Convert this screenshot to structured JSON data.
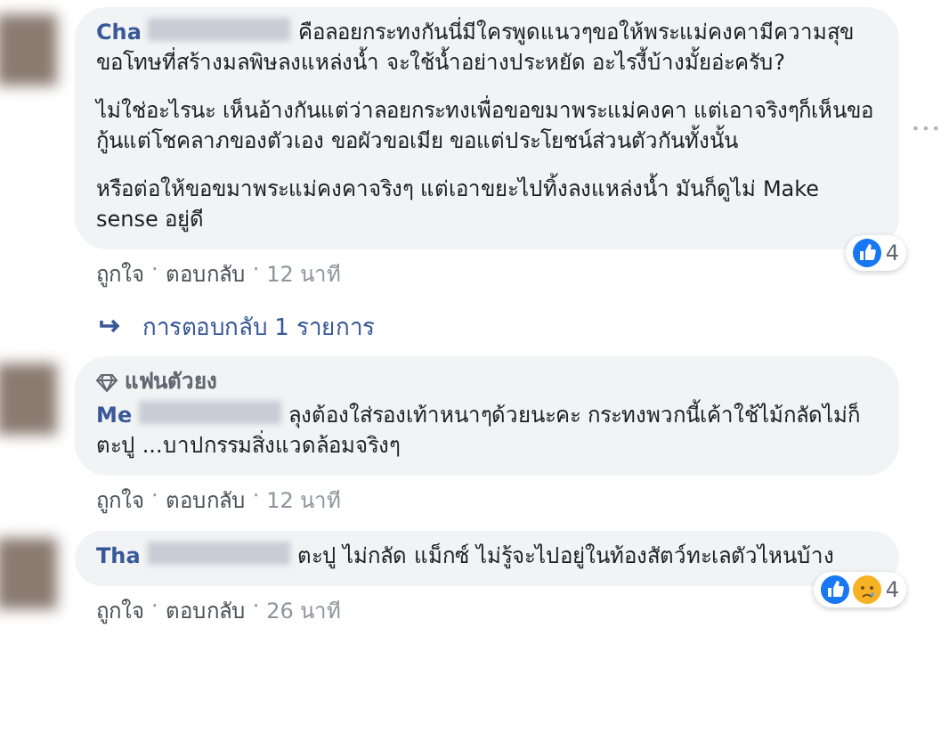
{
  "comments": [
    {
      "author": "Cha",
      "paragraphs": [
        "คือลอยกระทงกันนี่มีใครพูดแนวๆขอให้พระแม่คงคามีความสุข ขอโทษที่สร้างมลพิษลงแหล่งน้ำ จะใช้น้ำอย่างประหยัด อะไรงี้บ้างมั้ยอ่ะครับ?",
        "ไม่ใช่อะไรนะ เห็นอ้างกันแต่ว่าลอยกระทงเพื่อขอขมาพระแม่คงคา แต่เอาจริงๆก็เห็นขอกู้นแต่โชคลาภของตัวเอง ขอผัวขอเมีย ขอแต่ประโยชน์ส่วนตัวกันทั้งนั้น",
        "หรือต่อให้ขอขมาพระแม่คงคาจริงๆ แต่เอาขยะไปทิ้งลงแหล่งน้ำ มันก็ดูไม่ Make sense อยู่ดี"
      ],
      "reactions": [
        {
          "kind": "like"
        }
      ],
      "reaction_count": "4",
      "actions": [
        {
          "kind": "link",
          "text": "ถูกใจ"
        },
        {
          "kind": "dot",
          "text": "·"
        },
        {
          "kind": "link",
          "text": "ตอบกลับ"
        },
        {
          "kind": "dot",
          "text": "·"
        },
        {
          "kind": "time",
          "text": "12 นาที"
        }
      ],
      "replies_link": "การตอบกลับ 1 รายการ",
      "more_button": "•••"
    },
    {
      "author": "Me",
      "badge": "แฟนตัวยง",
      "paragraphs": [
        "ลุงต้องใส่รองเท้าหนาๆด้วยนะคะ กระทงพวกนี้เค้าใช้ไม้กลัดไม่ก็ตะปู ...บาปกรรมสิ่งแวดล้อมจริงๆ"
      ],
      "actions": [
        {
          "kind": "link",
          "text": "ถูกใจ"
        },
        {
          "kind": "dot",
          "text": "·"
        },
        {
          "kind": "link",
          "text": "ตอบกลับ"
        },
        {
          "kind": "dot",
          "text": "·"
        },
        {
          "kind": "time",
          "text": "12 นาที"
        }
      ]
    },
    {
      "author": "Tha",
      "paragraphs": [
        "ตะปู ไม่กลัด แม็กซ์ ไม่รู้จะไปอยู่ในท้องสัตว์ทะเลตัวไหนบ้าง"
      ],
      "reactions": [
        {
          "kind": "like"
        },
        {
          "kind": "sad"
        }
      ],
      "reaction_count": "4",
      "actions": [
        {
          "kind": "link",
          "text": "ถูกใจ"
        },
        {
          "kind": "dot",
          "text": "·"
        },
        {
          "kind": "link",
          "text": "ตอบกลับ"
        },
        {
          "kind": "dot",
          "text": "·"
        },
        {
          "kind": "time",
          "text": "26 นาที"
        }
      ]
    }
  ]
}
